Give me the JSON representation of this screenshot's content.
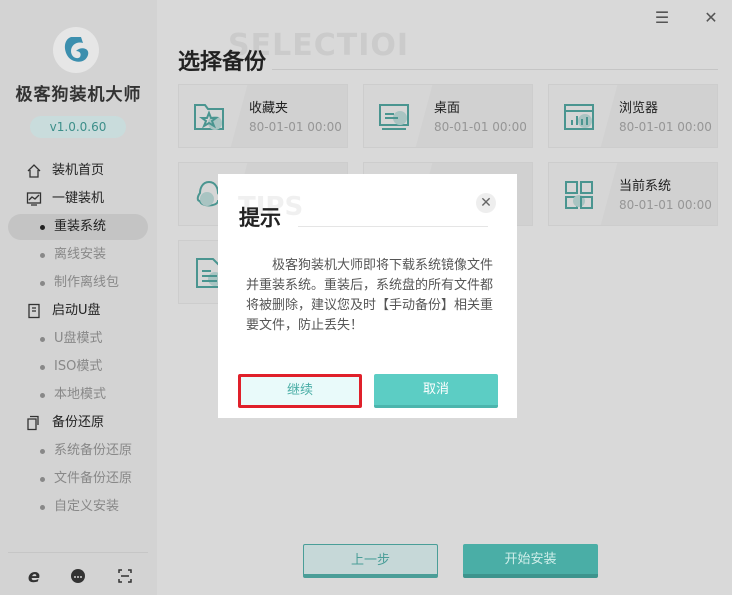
{
  "app": {
    "name": "极客狗装机大师",
    "version": "v1.0.0.60"
  },
  "window": {
    "menu_icon": "menu-icon",
    "close_icon": "close-icon"
  },
  "sidebar": {
    "items": [
      {
        "label": "装机首页",
        "type": "top",
        "icon": "home-icon"
      },
      {
        "label": "一键装机",
        "type": "top",
        "icon": "monitor-chart-icon"
      },
      {
        "label": "重装系统",
        "type": "sub",
        "selected": true
      },
      {
        "label": "离线安装",
        "type": "sub"
      },
      {
        "label": "制作离线包",
        "type": "sub"
      },
      {
        "label": "启动U盘",
        "type": "top",
        "icon": "usb-icon"
      },
      {
        "label": "U盘模式",
        "type": "sub"
      },
      {
        "label": "ISO模式",
        "type": "sub"
      },
      {
        "label": "本地模式",
        "type": "sub"
      },
      {
        "label": "备份还原",
        "type": "top",
        "icon": "backup-icon"
      },
      {
        "label": "系统备份还原",
        "type": "sub"
      },
      {
        "label": "文件备份还原",
        "type": "sub"
      },
      {
        "label": "自定义安装",
        "type": "sub"
      }
    ],
    "footer_icons": [
      "ie-browser-icon",
      "customer-service-icon",
      "scan-icon"
    ]
  },
  "main": {
    "watermark": "SELECTIOI",
    "title": "选择备份",
    "cards": [
      {
        "name": "收藏夹",
        "date": "80-01-01 00:00",
        "icon": "favorites-folder-icon"
      },
      {
        "name": "桌面",
        "date": "80-01-01 00:00",
        "icon": "desktop-icon"
      },
      {
        "name": "浏览器",
        "date": "80-01-01 00:00",
        "icon": "browser-icon"
      },
      {
        "name": "",
        "date": "",
        "icon": "qq-icon"
      },
      {
        "name": "",
        "date": "",
        "icon": ""
      },
      {
        "name": "当前系统",
        "date": "80-01-01 00:00",
        "icon": "system-grid-icon"
      },
      {
        "name": "",
        "date": "",
        "icon": "document-icon"
      }
    ],
    "prev_label": "上一步",
    "install_label": "开始安装"
  },
  "dialog": {
    "watermark": "TIPS",
    "title": "提示",
    "message": "极客狗装机大师即将下载系统镜像文件并重装系统。重装后，系统盘的所有文件都将被删除，建议您及时【手动备份】相关重要文件，防止丢失！",
    "continue_label": "继续",
    "cancel_label": "取消"
  },
  "colors": {
    "accent": "#5ccdc4",
    "highlight_border": "#e0202a"
  }
}
